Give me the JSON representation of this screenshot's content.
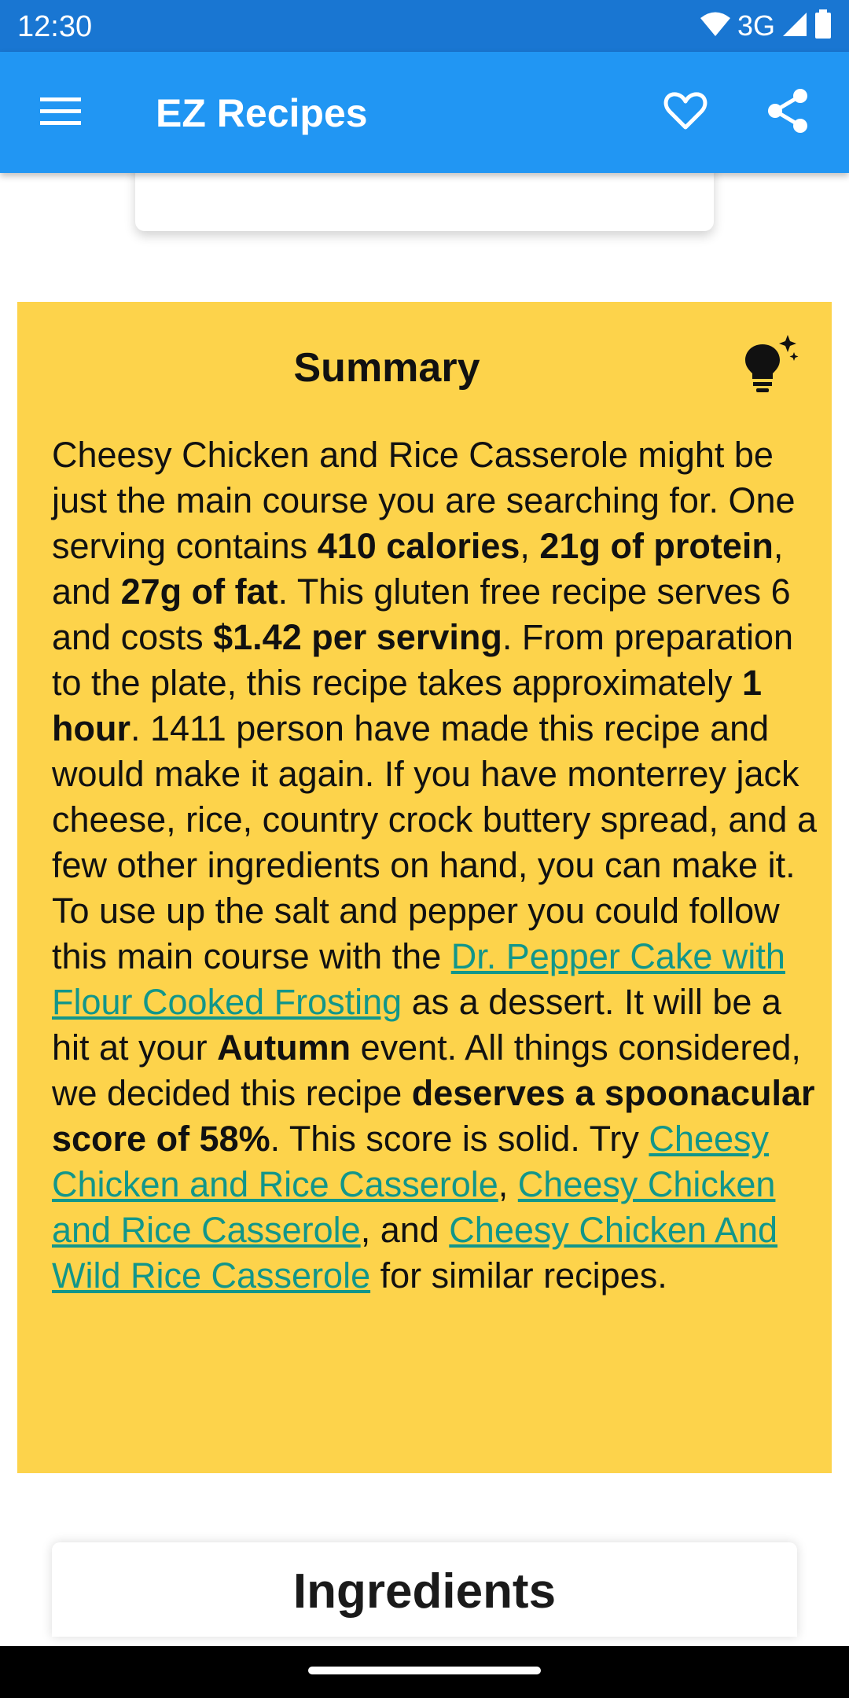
{
  "status_bar": {
    "time": "12:30",
    "network": "3G"
  },
  "app_bar": {
    "title": "EZ Recipes",
    "menu_icon": "hamburger-menu-icon",
    "favorite_icon": "heart-outline-icon",
    "share_icon": "share-icon"
  },
  "summary": {
    "title": "Summary",
    "icon": "lightbulb-sparkle-icon",
    "text_parts": {
      "p01": "Cheesy Chicken and Rice Casserole might be just the main course you are searching for. One serving contains ",
      "b01": "410 calories",
      "p02": ", ",
      "b02": "21g of protein",
      "p03": ", and ",
      "b03": "27g of fat",
      "p04": ". This gluten free recipe serves 6 and costs ",
      "b04": "$1.42 per serving",
      "p05": ". From preparation to the plate, this recipe takes approximately ",
      "b05": "1 hour",
      "p06": ". 1411 person have made this recipe and would make it again. If you have monterrey jack cheese, rice, country crock buttery spread, and a few other ingredients on hand, you can make it. To use up the salt and pepper you could follow this main course with the ",
      "l01": "Dr. Pepper Cake with Flour Cooked Frosting",
      "p07": " as a dessert. It will be a hit at your ",
      "b06": "Autumn",
      "p08": " event. All things considered, we decided this recipe ",
      "b07": "deserves a spoonacular score of 58%",
      "p09": ". This score is solid. Try ",
      "l02": "Cheesy Chicken and Rice Casserole",
      "p10": ", ",
      "l03": "Cheesy Chicken and Rice Casserole",
      "p11": ", and ",
      "l04": "Cheesy Chicken And Wild Rice Casserole",
      "p12": " for similar recipes."
    }
  },
  "ingredients": {
    "title": "Ingredients"
  },
  "colors": {
    "status_bar": "#1976d2",
    "app_bar": "#2196f3",
    "summary_background": "#fdd34b",
    "link": "#12968a"
  }
}
